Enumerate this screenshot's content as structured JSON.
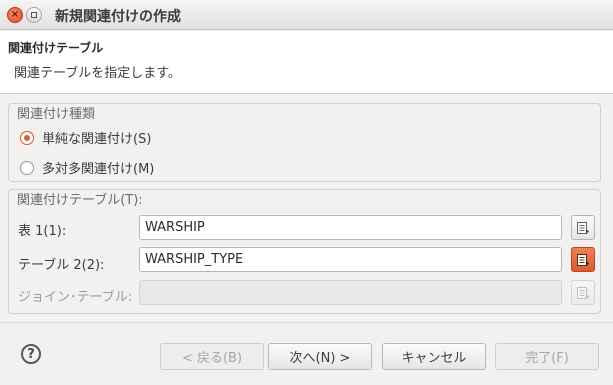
{
  "window": {
    "title": "新規関連付けの作成"
  },
  "header": {
    "title": "関連付けテーブル",
    "description": "関連テーブルを指定します。"
  },
  "association_type": {
    "group_label": "関連付け種類",
    "options": [
      {
        "label": "単純な関連付け(S)",
        "checked": true
      },
      {
        "label": "多対多関連付け(M)",
        "checked": false
      }
    ]
  },
  "association_tables": {
    "group_label": "関連付けテーブル(T):",
    "fields": [
      {
        "label": "表 1(1):",
        "value": "WARSHIP",
        "enabled": true
      },
      {
        "label": "テーブル 2(2):",
        "value": "WARSHIP_TYPE",
        "enabled": true
      },
      {
        "label": "ジョイン･テーブル:",
        "value": "",
        "enabled": false
      }
    ]
  },
  "footer": {
    "help_glyph": "?",
    "back_label": "< 戻る(B)",
    "next_label": "次へ(N) >",
    "cancel_label": "キャンセル",
    "finish_label": "完了(F)"
  },
  "colors": {
    "accent": "#e05a2b"
  },
  "icons": [
    "close-icon",
    "maximize-icon",
    "browse-table-icon",
    "help-icon"
  ]
}
